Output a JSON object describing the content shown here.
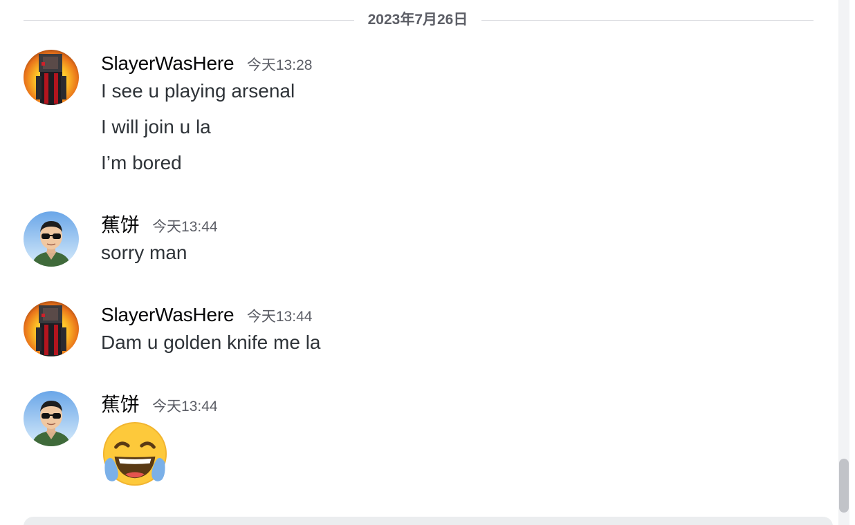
{
  "date_divider": {
    "label": "2023年7月26日"
  },
  "messages": [
    {
      "username": "SlayerWasHere",
      "timestamp": "今天13:28",
      "avatar": "minecraft-skin-avatar",
      "lines": [
        "I see u playing arsenal",
        "I will join u la",
        "I’m bored"
      ]
    },
    {
      "username": "蕉饼",
      "timestamp": "今天13:44",
      "avatar": "sunglasses-man-avatar",
      "lines": [
        "sorry man"
      ]
    },
    {
      "username": "SlayerWasHere",
      "timestamp": "今天13:44",
      "avatar": "minecraft-skin-avatar",
      "lines": [
        "Dam u golden knife me la"
      ]
    },
    {
      "username": "蕉饼",
      "timestamp": "今天13:44",
      "avatar": "sunglasses-man-avatar",
      "emoji": "face-with-tears-of-joy-icon"
    }
  ],
  "colors": {
    "username": "#060607",
    "timestamp": "#5c5e66",
    "message_text": "#2e3338",
    "divider_line": "#dcdde1",
    "scroll_thumb": "#c1c3c8"
  }
}
